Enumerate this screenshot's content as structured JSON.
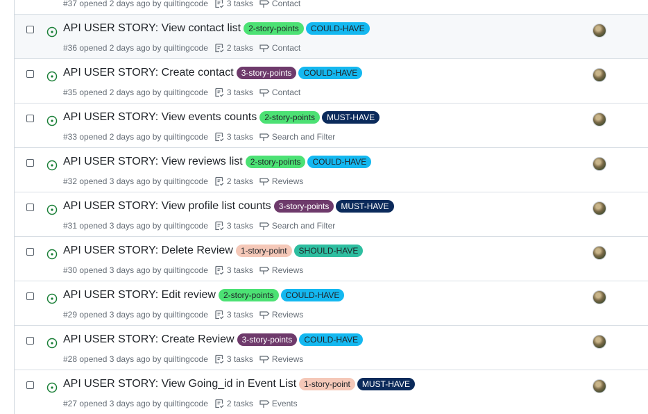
{
  "colors": {
    "open_icon": "#1a7f37",
    "label_2sp": "#4ce174",
    "label_3sp": "#6e3a6b",
    "label_1sp": "#f5c8b8",
    "could_have": "#14b8f0",
    "must_have": "#0b2a5b",
    "should_have": "#2ebea0"
  },
  "issues": [
    {
      "number": "#37",
      "opened": "opened 2 days ago by",
      "author": "quiltingcode",
      "tasks": "3 tasks",
      "milestone": "Contact",
      "title": "",
      "labels": []
    },
    {
      "number": "#36",
      "title": "API USER STORY: View contact list",
      "opened": "opened 2 days ago by",
      "author": "quiltingcode",
      "tasks": "2 tasks",
      "milestone": "Contact",
      "labels": [
        {
          "text": "2-story-points",
          "bg": "#4ce174",
          "fg": "#1f2328"
        },
        {
          "text": "COULD-HAVE",
          "bg": "#14b8f0",
          "fg": "#1f2328"
        }
      ]
    },
    {
      "number": "#35",
      "title": "API USER STORY: Create contact",
      "opened": "opened 2 days ago by",
      "author": "quiltingcode",
      "tasks": "3 tasks",
      "milestone": "Contact",
      "labels": [
        {
          "text": "3-story-points",
          "bg": "#6e3a6b",
          "fg": "#ffffff"
        },
        {
          "text": "COULD-HAVE",
          "bg": "#14b8f0",
          "fg": "#1f2328"
        }
      ]
    },
    {
      "number": "#33",
      "title": "API USER STORY: View events counts",
      "opened": "opened 2 days ago by",
      "author": "quiltingcode",
      "tasks": "3 tasks",
      "milestone": "Search and Filter",
      "labels": [
        {
          "text": "2-story-points",
          "bg": "#4ce174",
          "fg": "#1f2328"
        },
        {
          "text": "MUST-HAVE",
          "bg": "#0b2a5b",
          "fg": "#ffffff"
        }
      ]
    },
    {
      "number": "#32",
      "title": "API USER STORY: View reviews list",
      "opened": "opened 3 days ago by",
      "author": "quiltingcode",
      "tasks": "2 tasks",
      "milestone": "Reviews",
      "labels": [
        {
          "text": "2-story-points",
          "bg": "#4ce174",
          "fg": "#1f2328"
        },
        {
          "text": "COULD-HAVE",
          "bg": "#14b8f0",
          "fg": "#1f2328"
        }
      ]
    },
    {
      "number": "#31",
      "title": "API USER STORY: View profile list counts",
      "opened": "opened 3 days ago by",
      "author": "quiltingcode",
      "tasks": "3 tasks",
      "milestone": "Search and Filter",
      "labels": [
        {
          "text": "3-story-points",
          "bg": "#6e3a6b",
          "fg": "#ffffff"
        },
        {
          "text": "MUST-HAVE",
          "bg": "#0b2a5b",
          "fg": "#ffffff"
        }
      ]
    },
    {
      "number": "#30",
      "title": "API USER STORY: Delete Review",
      "opened": "opened 3 days ago by",
      "author": "quiltingcode",
      "tasks": "3 tasks",
      "milestone": "Reviews",
      "labels": [
        {
          "text": "1-story-point",
          "bg": "#f5c8b8",
          "fg": "#1f2328"
        },
        {
          "text": "SHOULD-HAVE",
          "bg": "#2ebea0",
          "fg": "#1f2328"
        }
      ]
    },
    {
      "number": "#29",
      "title": "API USER STORY: Edit review",
      "opened": "opened 3 days ago by",
      "author": "quiltingcode",
      "tasks": "3 tasks",
      "milestone": "Reviews",
      "labels": [
        {
          "text": "2-story-points",
          "bg": "#4ce174",
          "fg": "#1f2328"
        },
        {
          "text": "COULD-HAVE",
          "bg": "#14b8f0",
          "fg": "#1f2328"
        }
      ]
    },
    {
      "number": "#28",
      "title": "API USER STORY: Create Review",
      "opened": "opened 3 days ago by",
      "author": "quiltingcode",
      "tasks": "3 tasks",
      "milestone": "Reviews",
      "labels": [
        {
          "text": "3-story-points",
          "bg": "#6e3a6b",
          "fg": "#ffffff"
        },
        {
          "text": "COULD-HAVE",
          "bg": "#14b8f0",
          "fg": "#1f2328"
        }
      ]
    },
    {
      "number": "#27",
      "title": "API USER STORY: View Going_id in Event List",
      "opened": "opened 3 days ago by",
      "author": "quiltingcode",
      "tasks": "2 tasks",
      "milestone": "Events",
      "labels": [
        {
          "text": "1-story-point",
          "bg": "#f5c8b8",
          "fg": "#1f2328"
        },
        {
          "text": "MUST-HAVE",
          "bg": "#0b2a5b",
          "fg": "#ffffff"
        }
      ]
    }
  ]
}
